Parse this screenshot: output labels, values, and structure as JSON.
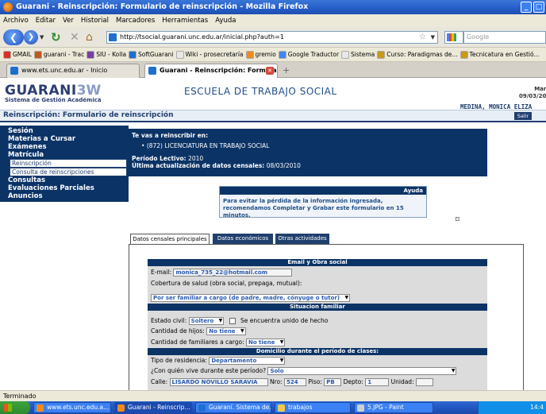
{
  "window": {
    "title": "Guarani - Reinscripción: Formulario de reinscripción - Mozilla Firefox"
  },
  "menu": [
    "Archivo",
    "Editar",
    "Ver",
    "Historial",
    "Marcadores",
    "Herramientas",
    "Ayuda"
  ],
  "nav": {
    "url": "http://tsocial.guarani.unc.edu.ar/inicial.php?auth=1",
    "search_placeholder": "Google"
  },
  "bookmarks": [
    {
      "label": "GMAIL",
      "color": "#d93025"
    },
    {
      "label": "guarani - Trac",
      "color": "#c05a1e"
    },
    {
      "label": "SIU - Kolla",
      "color": "#7a3fa0"
    },
    {
      "label": "SoftGuarani",
      "color": "#1e6fd0"
    },
    {
      "label": "Wiki - prosecretaría",
      "color": "#e8e8e8"
    },
    {
      "label": "gremio",
      "color": "#f08a1c"
    },
    {
      "label": "Google Traductor",
      "color": "#4285f4"
    },
    {
      "label": "Sistema",
      "color": "#e8e8e8"
    },
    {
      "label": "Curso: Paradigmas de...",
      "color": "#c89a1a"
    },
    {
      "label": "Tecnicatura en Gestió...",
      "color": "#c89a1a"
    }
  ],
  "tabs": [
    {
      "label": "www.ets.unc.edu.ar - Inicio"
    },
    {
      "label": "Guarani - Reinscripción: Formular..."
    }
  ],
  "header": {
    "logo": "GUARANI",
    "logo_suffix": "3W",
    "logo_sub": "Sistema de Gestión Académica",
    "school": "ESCUELA DE TRABAJO SOCIAL",
    "date_day": "Mar",
    "date": "09/03/20",
    "user": "MEDINA, MONICA ELIZA",
    "page_title": "Reinscripción: Formulario de reinscripción",
    "logout": "Salir"
  },
  "sidebar": {
    "items": [
      "Sesión",
      "Materias a Cursar",
      "Exámenes",
      "Matrícula"
    ],
    "subitems": [
      "Reinscripción",
      "Consulta de reinscripciones"
    ],
    "items2": [
      "Consultas",
      "Evaluaciones Parciales",
      "Anuncios"
    ]
  },
  "info": {
    "heading": "Te vas a reinscribir en:",
    "career": "(872) LICENCIATURA EN TRABAJO SOCIAL",
    "period_label": "Período Lectivo:",
    "period": "2010",
    "update_label": "Última actualización de datos censales:",
    "update": "08/03/2010"
  },
  "ayuda": {
    "title": "Ayuda",
    "text": "Para evitar la pérdida de la información ingresada, recomendamos Completar y Grabar este formulario en 15 minutos."
  },
  "form_tabs": [
    "Datos censales principales",
    "Datos económicos",
    "Otras actividades"
  ],
  "form": {
    "sec1": "Email y Obra social",
    "email_label": "E-mail:",
    "email": "monica_735_22@hotmail.com",
    "cobertura_label": "Cobertura de salud (obra social, prepaga, mutual):",
    "cobertura": "Por ser familiar a cargo (de padre, madre, cónyuge o tutor)",
    "sec2": "Situacion familiar",
    "civil_label": "Estado civil:",
    "civil": "Soltero",
    "unido_label": "Se encuentra unido de hecho",
    "hijos_label": "Cantidad de hijos:",
    "hijos": "No tiene",
    "familiares_label": "Cantidad de familiares a cargo:",
    "familiares": "No tiene",
    "sec3": "Domicilio durante el período de clases:",
    "residencia_label": "Tipo de residencia:",
    "residencia": "Departamento",
    "convive_label": "¿Con quién vive durante este período?",
    "convive": "Solo",
    "calle_label": "Calle:",
    "calle": "LISARDO NOVILLO SARAVIA",
    "nro_label": "Nro:",
    "nro": "524",
    "piso_label": "Piso:",
    "piso": "PB",
    "dpto_label": "Depto:",
    "dpto": "1",
    "unidad_label": "Unidad:"
  },
  "status": "Terminado",
  "taskbar": {
    "items": [
      {
        "label": "www.ets.unc.edu.a...",
        "color": "#f08a1c"
      },
      {
        "label": "Guarani - Reinscrip...",
        "color": "#f08a1c"
      },
      {
        "label": "Guaraní. Sistema de...",
        "color": "#1e6fd0"
      },
      {
        "label": "trabajos",
        "color": "#f2c94c"
      },
      {
        "label": "5.JPG - Paint",
        "color": "#d0d0d0"
      }
    ],
    "clock": "14:4"
  }
}
